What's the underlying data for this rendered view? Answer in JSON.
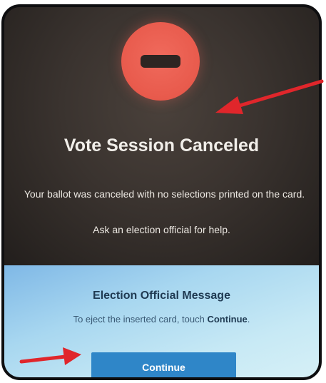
{
  "screen": {
    "title": "Vote Session Canceled",
    "description": "Your ballot was canceled with no selections printed on the card.",
    "help_text": "Ask an election official for help."
  },
  "official_message": {
    "title": "Election Official Message",
    "text_prefix": "To eject the inserted card, touch ",
    "text_emphasis": "Continue",
    "text_suffix": "."
  },
  "continue_button": {
    "label": "Continue"
  },
  "icons": {
    "cancel": "cancel-circle-icon",
    "annotation_arrows": "arrow-icon"
  },
  "colors": {
    "cancel_icon": "#e85a4c",
    "button": "#2f86c8",
    "arrow": "#e0262b"
  }
}
